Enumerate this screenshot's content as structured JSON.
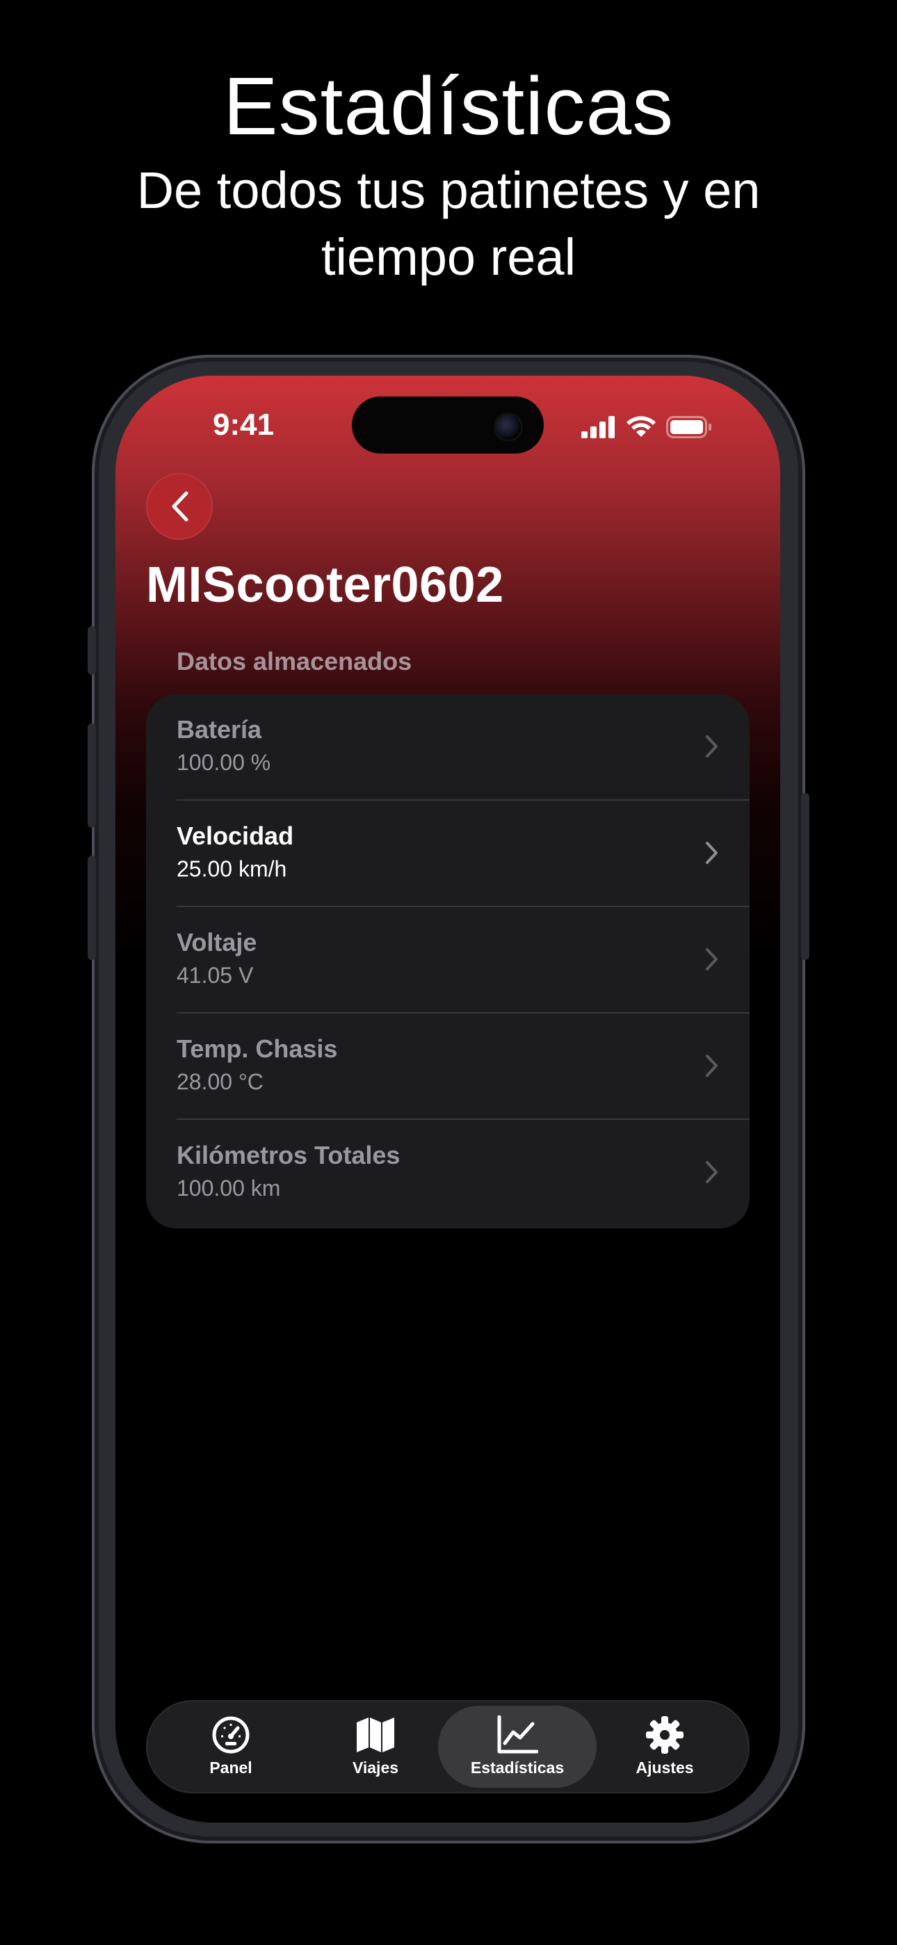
{
  "promo": {
    "headline": "Estadísticas",
    "subline": "De todos tus patinetes y en tiempo real"
  },
  "status_bar": {
    "time": "9:41",
    "icons": [
      "cellular-signal-icon",
      "wifi-icon",
      "battery-icon"
    ]
  },
  "header": {
    "back_icon": "chevron-left-icon",
    "device_name": "MIScooter0602"
  },
  "stats": {
    "section_title": "Datos almacenados",
    "items": [
      {
        "label": "Batería",
        "value": "100.00 %",
        "active": false
      },
      {
        "label": "Velocidad",
        "value": "25.00 km/h",
        "active": true
      },
      {
        "label": "Voltaje",
        "value": "41.05 V",
        "active": false
      },
      {
        "label": "Temp. Chasis",
        "value": "28.00 °C",
        "active": false
      },
      {
        "label": "Kilómetros Totales",
        "value": "100.00 km",
        "active": false
      }
    ]
  },
  "tab_bar": {
    "selected": "Estadísticas",
    "tabs": [
      {
        "label": "Panel",
        "icon": "speedometer-icon"
      },
      {
        "label": "Viajes",
        "icon": "map-icon"
      },
      {
        "label": "Estadísticas",
        "icon": "chart-line-icon"
      },
      {
        "label": "Ajustes",
        "icon": "gear-icon"
      }
    ]
  },
  "colors": {
    "accent_red": "#cc3338",
    "back_button": "#b3262c",
    "card": "#1c1c1e",
    "tab_bar": "#1f1f21",
    "tab_selected": "#3a3a3c"
  }
}
